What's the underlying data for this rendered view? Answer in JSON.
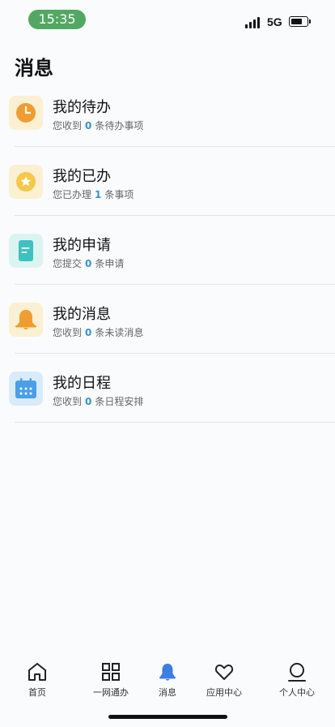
{
  "status_bar": {
    "time": "15:35",
    "network": "5G"
  },
  "page_title": "消息",
  "items": [
    {
      "title": "我的待办",
      "sub_prefix": "您收到",
      "count": "0",
      "sub_suffix": "条待办事项",
      "icon": "clock-icon",
      "tile_color": "#fbf0d2",
      "icon_color": "#ef9d32"
    },
    {
      "title": "我的已办",
      "sub_prefix": "您已办理",
      "count": "1",
      "sub_suffix": "条事项",
      "icon": "star-icon",
      "tile_color": "#fbf0d2",
      "icon_color": "#f5c84a"
    },
    {
      "title": "我的申请",
      "sub_prefix": "您提交",
      "count": "0",
      "sub_suffix": "条申请",
      "icon": "document-icon",
      "tile_color": "#dcf4f1",
      "icon_color": "#3dc2c0"
    },
    {
      "title": "我的消息",
      "sub_prefix": "您收到",
      "count": "0",
      "sub_suffix": "条未读消息",
      "icon": "bell-icon",
      "tile_color": "#fbf0d2",
      "icon_color": "#ef9d32"
    },
    {
      "title": "我的日程",
      "sub_prefix": "您收到",
      "count": "0",
      "sub_suffix": "条日程安排",
      "icon": "calendar-icon",
      "tile_color": "#d8ebfa",
      "icon_color": "#4a9fe8"
    }
  ],
  "tabs": [
    {
      "label": "首页",
      "icon": "home-icon",
      "active": false
    },
    {
      "label": "一网通办",
      "icon": "grid-icon",
      "active": false
    },
    {
      "label": "消息",
      "icon": "bell-icon",
      "active": true
    },
    {
      "label": "应用中心",
      "icon": "heart-icon",
      "active": false
    },
    {
      "label": "个人中心",
      "icon": "person-icon",
      "active": false
    }
  ],
  "colors": {
    "accent": "#3a8fd0",
    "time_pill": "#52a862",
    "active_tab_icon": "#3d7fe0"
  }
}
